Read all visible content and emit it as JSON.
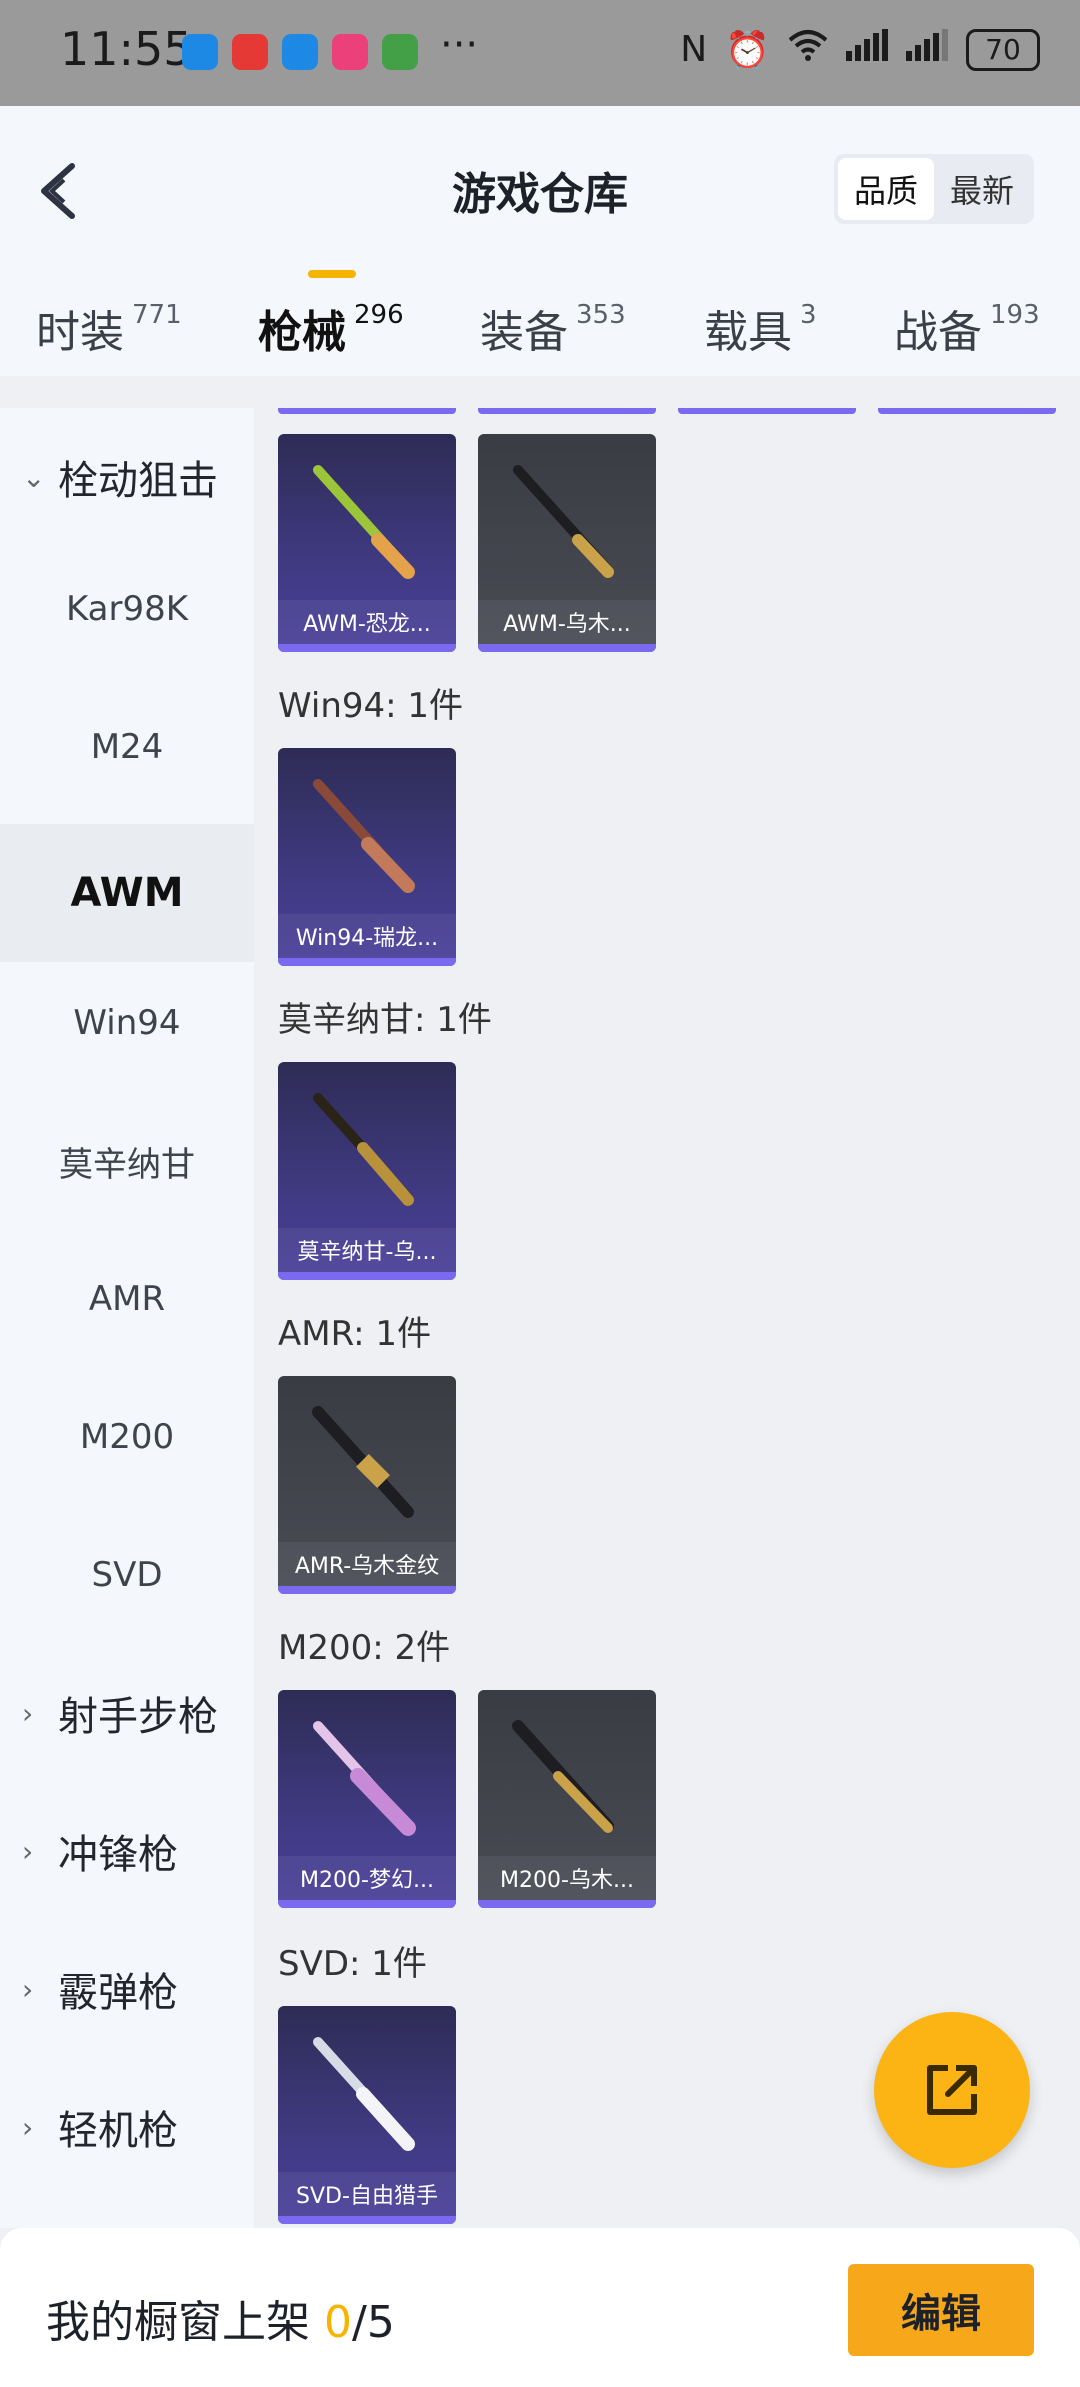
{
  "status_bar": {
    "time": "11:55",
    "more": "···",
    "battery": "70"
  },
  "header": {
    "title": "游戏仓库",
    "sort": {
      "quality": "品质",
      "latest": "最新"
    }
  },
  "tabs": [
    {
      "label": "时装",
      "count": "771"
    },
    {
      "label": "枪械",
      "count": "296"
    },
    {
      "label": "装备",
      "count": "353"
    },
    {
      "label": "载具",
      "count": "3"
    },
    {
      "label": "战备",
      "count": "193"
    }
  ],
  "sidebar": {
    "group_bolt": "栓动狙击",
    "items": [
      "Kar98K",
      "M24",
      "AWM",
      "Win94",
      "莫辛纳甘",
      "AMR",
      "M200",
      "SVD"
    ],
    "groups_collapsed": [
      "射手步枪",
      "冲锋枪",
      "霰弹枪",
      "轻机枪"
    ]
  },
  "sections": [
    {
      "label": "",
      "cards": [
        {
          "name": "AWM-恐龙...",
          "quality": "purple"
        },
        {
          "name": "AWM-乌木...",
          "quality": "gray"
        }
      ]
    },
    {
      "label": "Win94: 1件",
      "cards": [
        {
          "name": "Win94-瑞龙...",
          "quality": "purple"
        }
      ]
    },
    {
      "label": "莫辛纳甘: 1件",
      "cards": [
        {
          "name": "莫辛纳甘-乌...",
          "quality": "purple"
        }
      ]
    },
    {
      "label": "AMR: 1件",
      "cards": [
        {
          "name": "AMR-乌木金纹",
          "quality": "gray"
        }
      ]
    },
    {
      "label": "M200: 2件",
      "cards": [
        {
          "name": "M200-梦幻...",
          "quality": "purple"
        },
        {
          "name": "M200-乌木...",
          "quality": "gray"
        }
      ]
    },
    {
      "label": "SVD: 1件",
      "cards": [
        {
          "name": "SVD-自由猎手",
          "quality": "purple"
        }
      ]
    }
  ],
  "bottom_bar": {
    "label": "我的橱窗上架",
    "current": "0",
    "total": "/5",
    "edit": "编辑"
  },
  "colors": {
    "accent": "#f5b400",
    "purple_quality": "#7b6af0",
    "fab": "#fbb414"
  }
}
